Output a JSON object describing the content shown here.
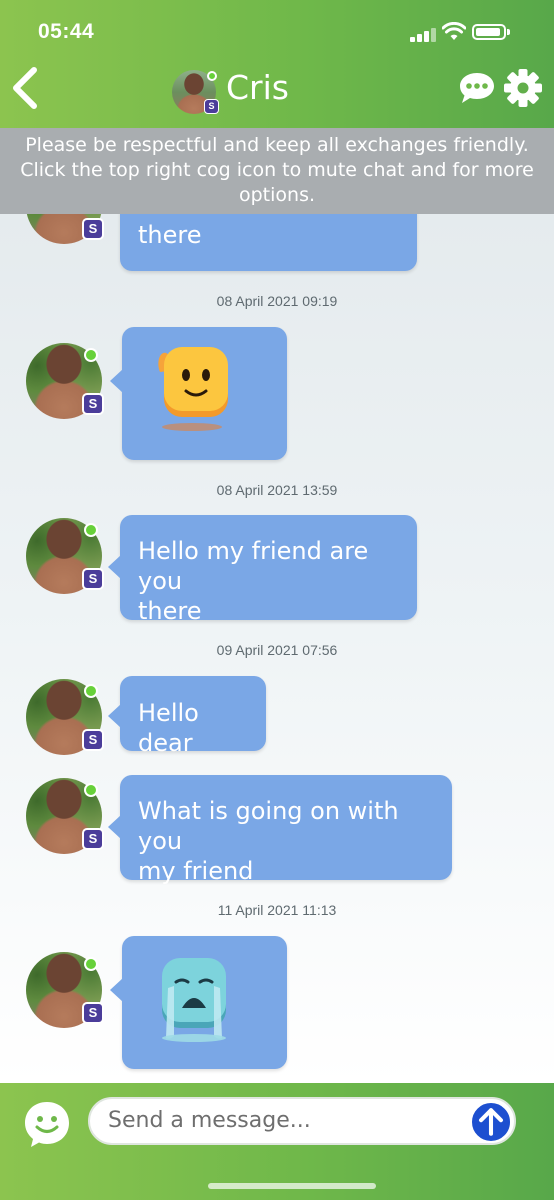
{
  "status_bar": {
    "time": "05:44"
  },
  "header": {
    "contact_name": "Cris",
    "badge_letter": "S"
  },
  "notice": {
    "line1": "Please be respectful and keep all exchanges friendly.",
    "line2": "Click the top right cog icon to mute chat and for more",
    "line3": "options."
  },
  "messages": [
    {
      "text_partial": "there"
    },
    {
      "timestamp": "08 April 2021 09:19"
    },
    {
      "emoji": "waving-emoji"
    },
    {
      "timestamp": "08 April 2021 13:59"
    },
    {
      "line1": "Hello my friend are you",
      "line2": "there"
    },
    {
      "timestamp": "09 April 2021 07:56"
    },
    {
      "text": "Hello dear"
    },
    {
      "line1": "What is going on with you",
      "line2": "my friend"
    },
    {
      "timestamp": "11 April 2021 11:13"
    },
    {
      "emoji": "crying-emoji"
    }
  ],
  "composer": {
    "placeholder": "Send a message..."
  },
  "colors": {
    "header_green": "#6fb84a",
    "bubble_blue": "#7aa7e6",
    "send_blue": "#1d4fd0",
    "notice_gray": "#a9adb0"
  }
}
